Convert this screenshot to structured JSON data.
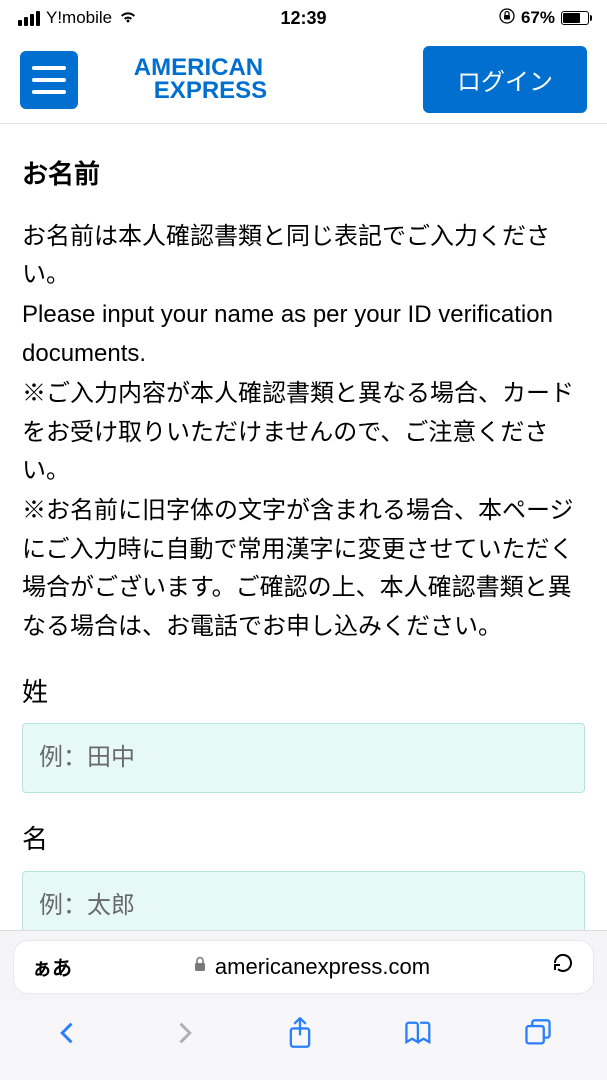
{
  "status": {
    "carrier": "Y!mobile",
    "time": "12:39",
    "battery_pct": "67%"
  },
  "header": {
    "brand_line1": "AMERICAN",
    "brand_line2": "EXPRESS",
    "login_label": "ログイン"
  },
  "form": {
    "section_title": "お名前",
    "instruction_jp": "お名前は本人確認書類と同じ表記でご入力ください。",
    "instruction_en": "Please input your name as per your ID verification documents.",
    "note1": "※ご入力内容が本人確認書類と異なる場合、カードをお受け取りいただけませんので、ご注意ください。",
    "note2": "※お名前に旧字体の文字が含まれる場合、本ページにご入力時に自動で常用漢字に変更させていただく場合がございます。ご確認の上、本人確認書類と異なる場合は、お電話でお申し込みください。",
    "surname_label": "姓",
    "surname_placeholder": "例：田中",
    "givenname_label": "名",
    "givenname_placeholder": "例：太郎"
  },
  "browser": {
    "aa": "ぁあ",
    "domain": "americanexpress.com"
  }
}
